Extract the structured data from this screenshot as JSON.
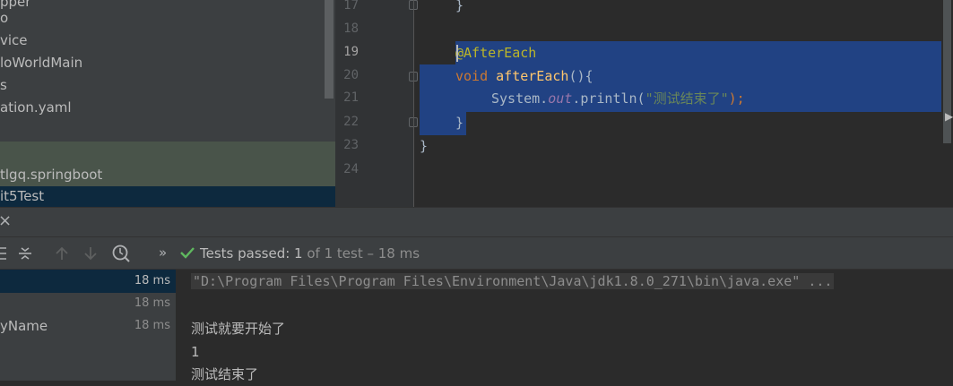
{
  "project_tree": {
    "items": [
      "pper",
      "o",
      "vice",
      "loWorldMain",
      "s",
      "ation.yaml",
      "tlgq.springboot",
      "it5Test"
    ]
  },
  "editor": {
    "line_numbers": [
      "17",
      "18",
      "19",
      "20",
      "21",
      "22",
      "23",
      "24"
    ],
    "code": {
      "l17": "}",
      "annotation": "@AfterEach",
      "kw_void": "void",
      "method": "afterEach",
      "paren": "(){",
      "sys": "System.",
      "out": "out",
      "println": ".println(",
      "string": "\"测试结束了\"",
      "end": ");",
      "l22": "}",
      "l23": "}"
    }
  },
  "run_window": {
    "close_glyph": "×",
    "more_glyph": "»",
    "status": {
      "prefix": "Tests passed: ",
      "count": "1",
      "rest": " of 1 test – 18 ms"
    },
    "test_tree": [
      {
        "name": "",
        "duration": "18 ms"
      },
      {
        "name": "",
        "duration": "18 ms"
      },
      {
        "name": "yName",
        "duration": "18 ms"
      }
    ],
    "console": [
      "\"D:\\Program Files\\Program Files\\Environment\\Java\\jdk1.8.0_271\\bin\\java.exe\" ...",
      "",
      "测试就要开始了",
      "1",
      "测试结束了"
    ]
  },
  "colors": {
    "selection": "#214283",
    "annotation": "#bbb529",
    "keyword": "#cc7832",
    "method": "#ffc66d",
    "string": "#6a8759",
    "pass_green": "#5fb85f"
  },
  "icons": [
    "collapse-all-icon",
    "expand-all-icon",
    "arrow-up-icon",
    "arrow-down-icon",
    "history-clock-icon",
    "check-icon",
    "close-icon"
  ]
}
